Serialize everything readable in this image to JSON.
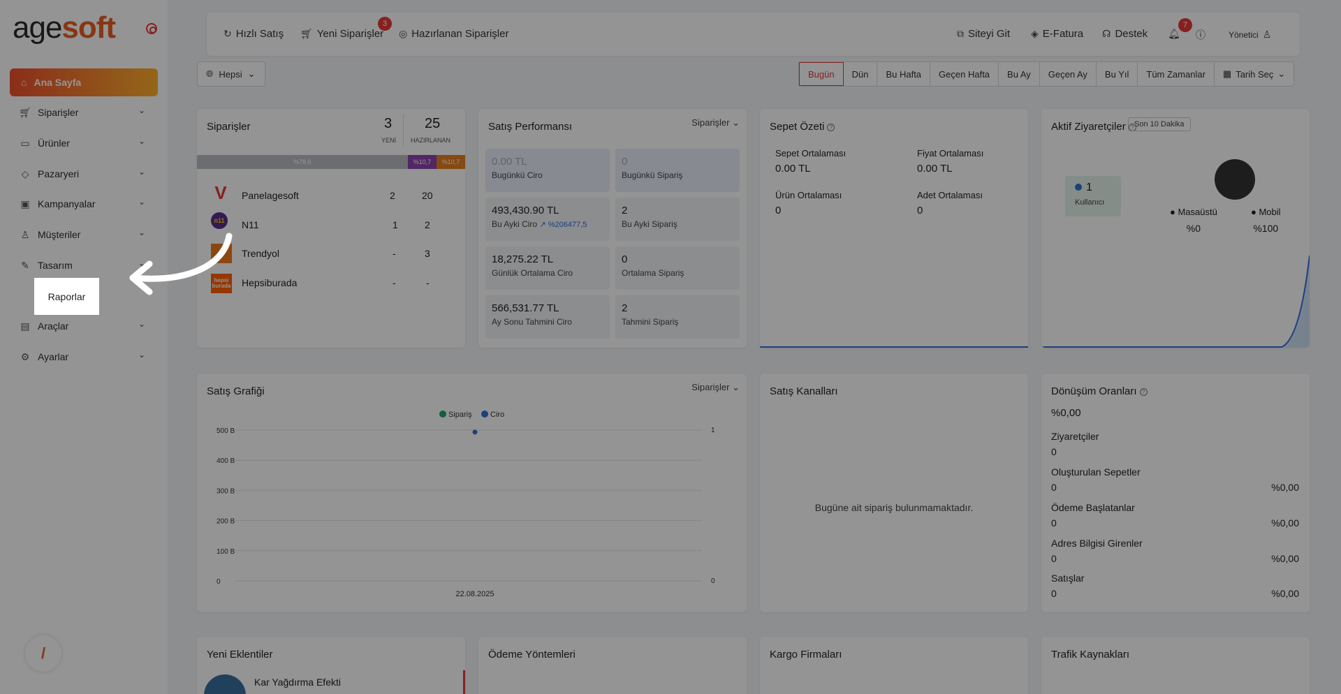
{
  "app": {
    "logo_main": "age",
    "logo_accent": "soft"
  },
  "sidebar": {
    "items": [
      {
        "label": "Ana Sayfa",
        "icon": "home-icon"
      },
      {
        "label": "Siparişler",
        "icon": "cart-icon"
      },
      {
        "label": "Ürünler",
        "icon": "book-icon"
      },
      {
        "label": "Pazaryeri",
        "icon": "box-icon"
      },
      {
        "label": "Kampanyalar",
        "icon": "basket-icon"
      },
      {
        "label": "Müşteriler",
        "icon": "user-icon"
      },
      {
        "label": "Tasarım",
        "icon": "edit-icon"
      },
      {
        "label": "Araçlar",
        "icon": "clipboard-icon"
      },
      {
        "label": "Ayarlar",
        "icon": "gear-icon"
      }
    ],
    "highlight_label": "Raporlar"
  },
  "topbar": {
    "hizli_satis": "Hızlı Satış",
    "yeni_siparisler": "Yeni Siparişler",
    "yeni_badge": "3",
    "hazirlanan": "Hazırlanan Siparişler",
    "siteyi_git": "Siteyi Git",
    "efatura": "E-Fatura",
    "destek": "Destek",
    "notif_badge": "7",
    "user": "Yönetici"
  },
  "filters": {
    "scope": "Hepsi",
    "ranges": [
      "Bugün",
      "Dün",
      "Bu Hafta",
      "Geçen Hafta",
      "Bu Ay",
      "Geçen Ay",
      "Bu Yıl",
      "Tüm Zamanlar"
    ],
    "active_range": "Bugün",
    "date_picker": "Tarih Seç"
  },
  "orders": {
    "title": "Siparişler",
    "new_count": "3",
    "new_label": "YENİ",
    "prep_count": "25",
    "prep_label": "HAZIRLANAN",
    "bar": [
      {
        "label": "%78,6",
        "pct": 78.6,
        "color": "#b9bcc3"
      },
      {
        "label": "%10,7",
        "pct": 10.7,
        "color": "#8e44ad"
      },
      {
        "label": "%10,7",
        "pct": 10.7,
        "color": "#e67e22"
      }
    ],
    "stores": [
      {
        "name": "Panelagesoft",
        "new": "2",
        "prep": "20"
      },
      {
        "name": "N11",
        "new": "1",
        "prep": "2"
      },
      {
        "name": "Trendyol",
        "new": "-",
        "prep": "3"
      },
      {
        "name": "Hepsiburada",
        "new": "-",
        "prep": "-"
      }
    ],
    "hb_logo": "hepsi burada"
  },
  "sales_perf": {
    "title": "Satış Performansı",
    "dropdown": "Siparişler",
    "metrics": [
      {
        "v": "0.00 TL",
        "l": "Bugünkü Ciro"
      },
      {
        "v": "0",
        "l": "Bugünkü Sipariş"
      },
      {
        "v": "493,430.90 TL",
        "l": "Bu Ayki Ciro",
        "extra": "%206477,5"
      },
      {
        "v": "2",
        "l": "Bu Ayki Sipariş"
      },
      {
        "v": "18,275.22 TL",
        "l": "Günlük Ortalama Ciro"
      },
      {
        "v": "0",
        "l": "Ortalama Sipariş"
      },
      {
        "v": "566,531.77 TL",
        "l": "Ay Sonu Tahmini Ciro"
      },
      {
        "v": "2",
        "l": "Tahmini Sipariş"
      }
    ]
  },
  "basket": {
    "title": "Sepet Özeti",
    "stats": [
      {
        "l": "Sepet Ortalaması",
        "v": "0.00 TL"
      },
      {
        "l": "Fiyat Ortalaması",
        "v": "0.00 TL"
      },
      {
        "l": "Ürün Ortalaması",
        "v": "0"
      },
      {
        "l": "Adet Ortalaması",
        "v": "0"
      }
    ]
  },
  "visitors": {
    "title": "Aktif Ziyaretçiler",
    "period": "Son 10 Dakika",
    "count": "1",
    "count_label": "Kullanıcı",
    "desktop_label": "Masaüstü",
    "desktop_pct": "%0",
    "mobile_label": "Mobil",
    "mobile_pct": "%100"
  },
  "sales_chart": {
    "title": "Satış Grafiği",
    "dropdown": "Siparişler",
    "legend": [
      "Sipariş",
      "Ciro"
    ],
    "legend_colors": [
      "#1aa566",
      "#2f6fd6"
    ],
    "y_left": [
      "500 B",
      "400 B",
      "300 B",
      "200 B",
      "100 B",
      "0"
    ],
    "y_right_top": "1",
    "y_right_bottom": "0",
    "x_label": "22.08.2025"
  },
  "chart_data": {
    "type": "line",
    "title": "Satış Grafiği",
    "categories": [
      "22.08.2025"
    ],
    "series": [
      {
        "name": "Sipariş",
        "values": [
          0
        ]
      },
      {
        "name": "Ciro",
        "values": [
          493430.9
        ]
      }
    ],
    "ylim": [
      0,
      500000
    ],
    "y2lim": [
      0,
      1
    ],
    "legend": "top-center",
    "grid": true
  },
  "channels": {
    "title": "Satış Kanalları",
    "empty": "Bugüne ait sipariş bulunmamaktadır."
  },
  "conversion": {
    "title": "Dönüşüm Oranları",
    "total": "%0,00",
    "rows": [
      {
        "t": "Ziyaretçiler",
        "n": "0",
        "p": ""
      },
      {
        "t": "Oluşturulan Sepetler",
        "n": "0",
        "p": "%0,00"
      },
      {
        "t": "Ödeme Başlatanlar",
        "n": "0",
        "p": "%0,00"
      },
      {
        "t": "Adres Bilgisi Girenler",
        "n": "0",
        "p": "%0,00"
      },
      {
        "t": "Satışlar",
        "n": "0",
        "p": "%0,00"
      }
    ]
  },
  "bottom": {
    "plugins": "Yeni Eklentiler",
    "plugin_item": "Kar Yağdırma Efekti",
    "payments": "Ödeme Yöntemleri",
    "cargo": "Kargo Firmaları",
    "traffic": "Trafik Kaynakları"
  }
}
